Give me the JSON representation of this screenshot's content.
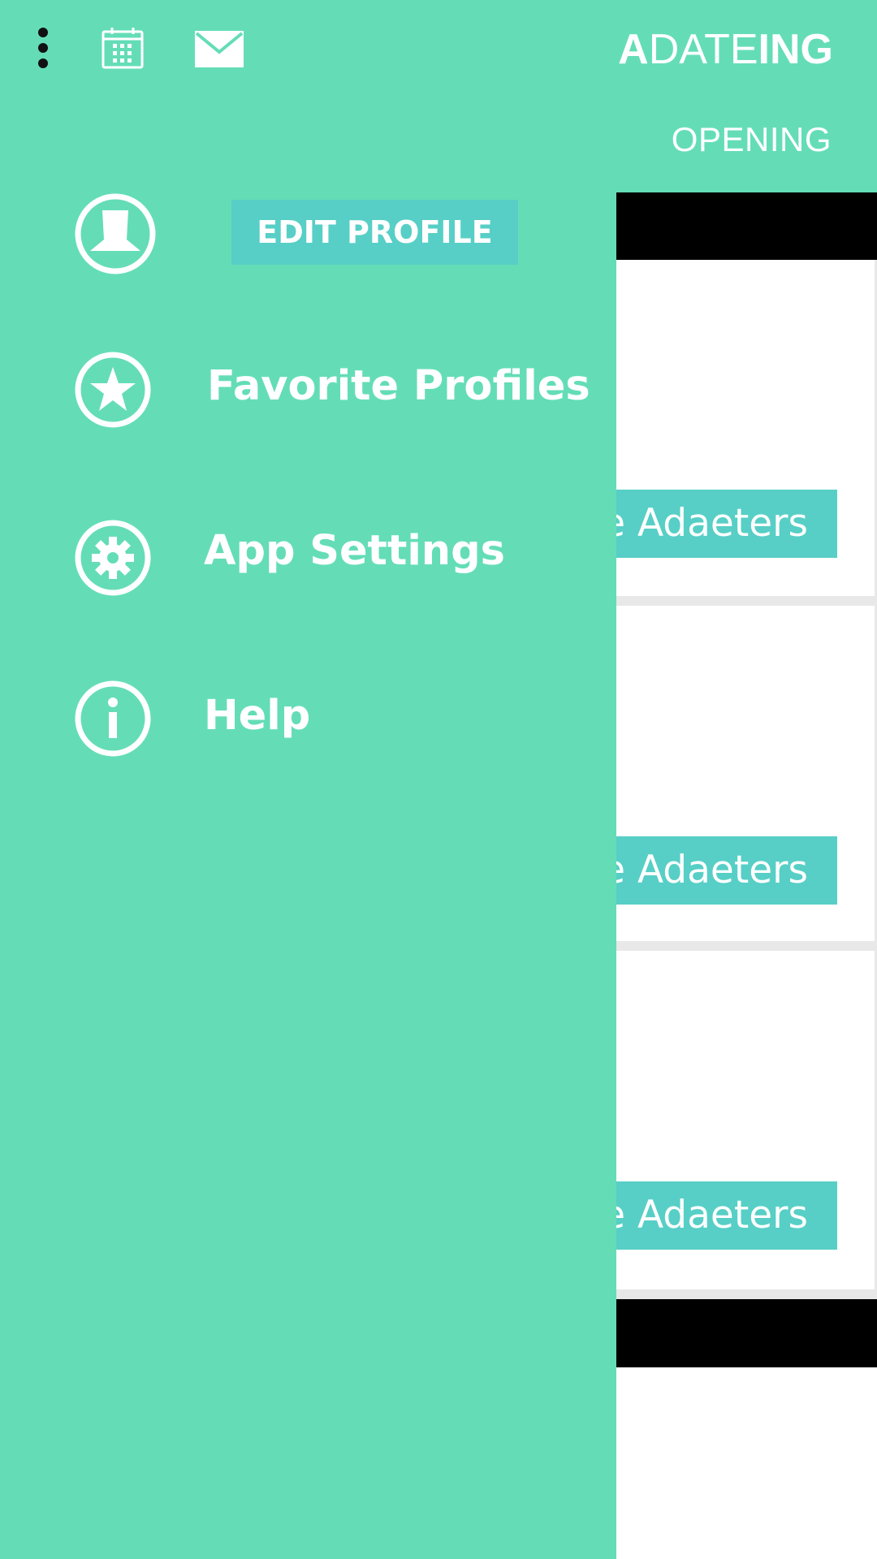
{
  "header": {
    "brand_a": "A",
    "brand_date": "DATE",
    "brand_i": "I",
    "brand_ng": "NG",
    "opening_label": "OPENING",
    "icons": [
      "more-vert-icon",
      "calendar-icon",
      "mail-icon"
    ]
  },
  "content": {
    "explore_buttons": [
      {
        "label": "Explore Adaeters"
      },
      {
        "label": "Explore Adaeters"
      },
      {
        "label": "Explore Adaeters"
      }
    ]
  },
  "drawer": {
    "edit_profile_label": "EDIT PROFILE",
    "items": [
      {
        "label": "Favorite Profiles",
        "icon": "star-icon"
      },
      {
        "label": "App Settings",
        "icon": "gear-icon"
      },
      {
        "label": "Help",
        "icon": "info-icon"
      }
    ]
  },
  "colors": {
    "accent": "#64ddb7",
    "button": "#57cfc6",
    "text": "#ffffff",
    "dark_bar": "#000000"
  }
}
